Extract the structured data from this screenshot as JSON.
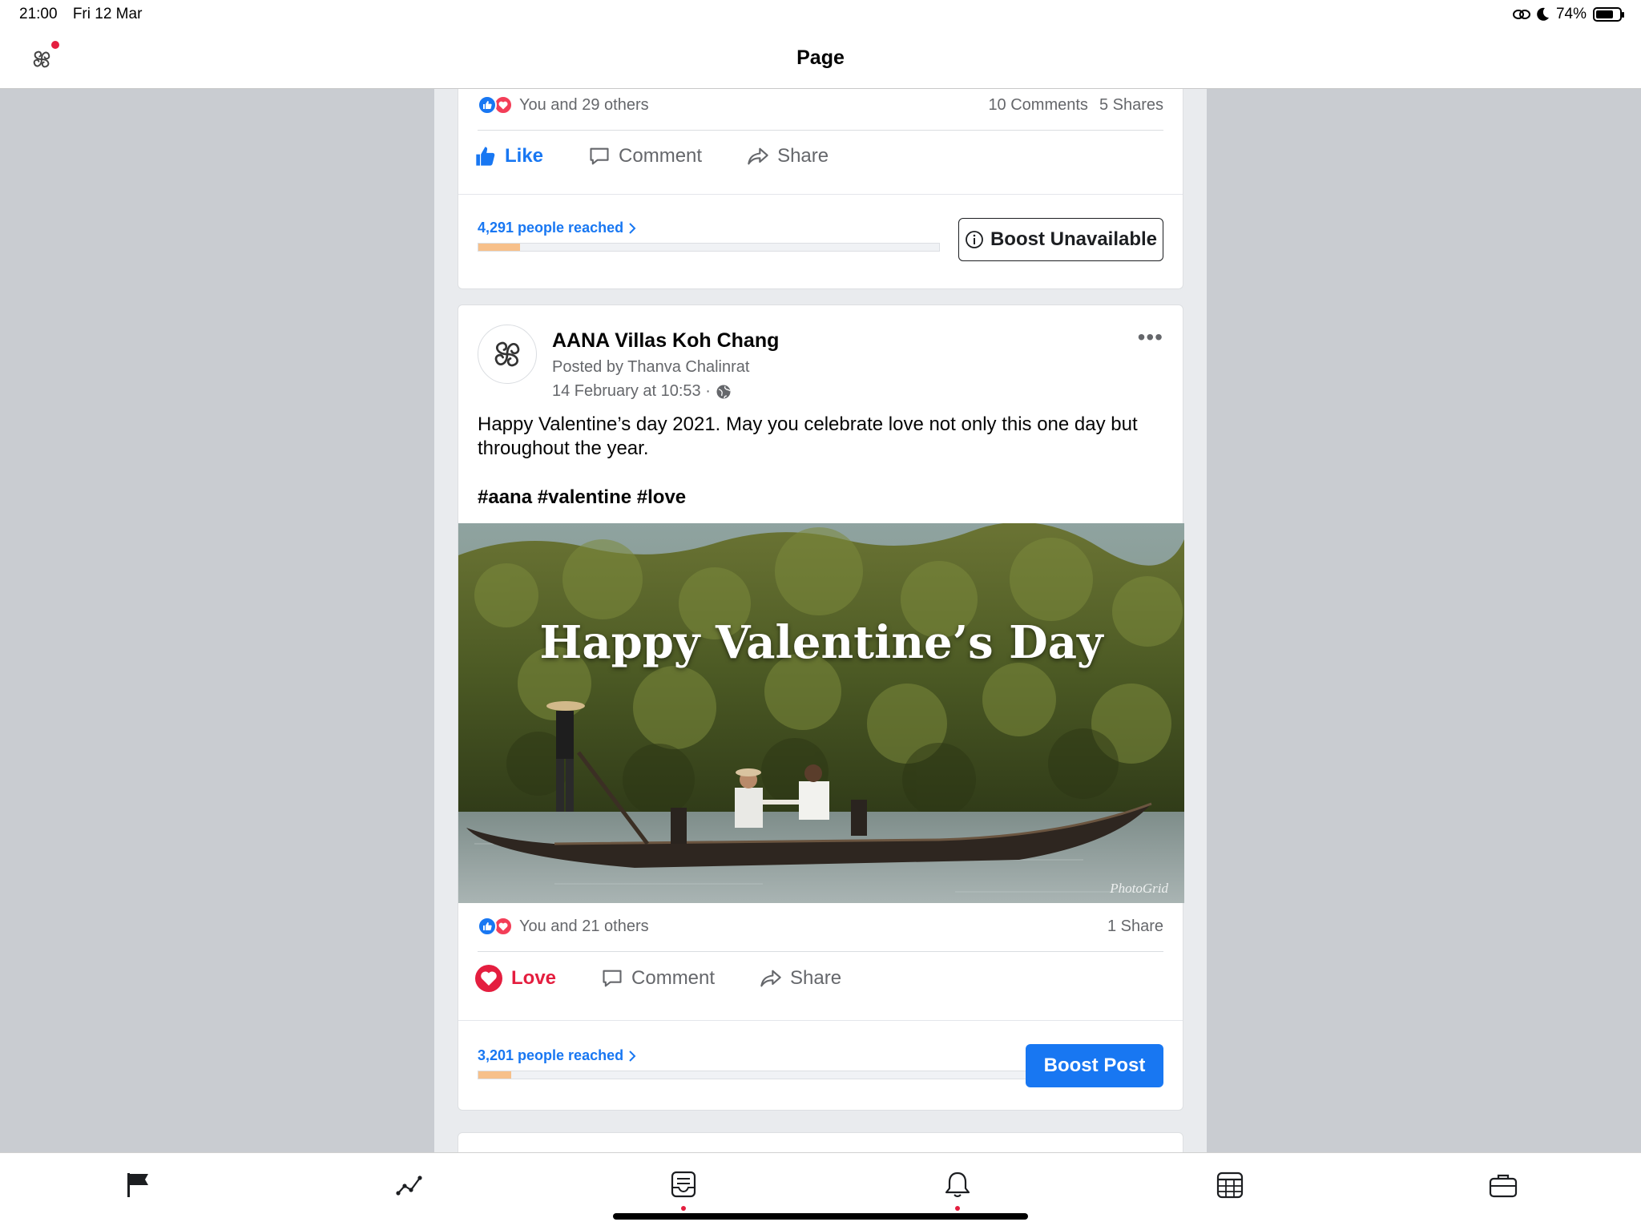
{
  "status_bar": {
    "time": "21:00",
    "date": "Fri 12 Mar",
    "battery_text": "74%",
    "battery_level": 0.74
  },
  "header": {
    "title": "Page",
    "app_icon": "aana-logo-icon"
  },
  "post1": {
    "reaction_text": "You and 29 others",
    "comments": "10 Comments",
    "shares": "5 Shares",
    "actions": {
      "like": "Like",
      "comment": "Comment",
      "share": "Share"
    },
    "reached": "4,291 people reached",
    "reach_fraction": 0.09,
    "boost_label": "Boost Unavailable"
  },
  "post2": {
    "page_name": "AANA Villas Koh Chang",
    "posted_by": "Posted by Thanva Chalinrat",
    "date": "14 February at 10:53 ·",
    "text": "Happy Valentine’s day 2021. May you celebrate love not only this one day but throughout the year.",
    "tags": "#aana #valentine #love",
    "image_caption": "Happy Valentine’s Day",
    "image_watermark": "PhotoGrid",
    "reaction_text": "You and 21 others",
    "shares": "1 Share",
    "actions": {
      "love": "Love",
      "comment": "Comment",
      "share": "Share"
    },
    "reached": "3,201 people reached",
    "reach_fraction": 0.06,
    "boost_label": "Boost Post"
  },
  "colors": {
    "facebook_blue": "#1877f2",
    "love_red": "#e41e3f",
    "reach_fill": "#f7c08a"
  },
  "tabs": [
    "flag-icon",
    "insights-icon",
    "inbox-icon",
    "bell-icon",
    "calendar-icon",
    "briefcase-icon"
  ]
}
